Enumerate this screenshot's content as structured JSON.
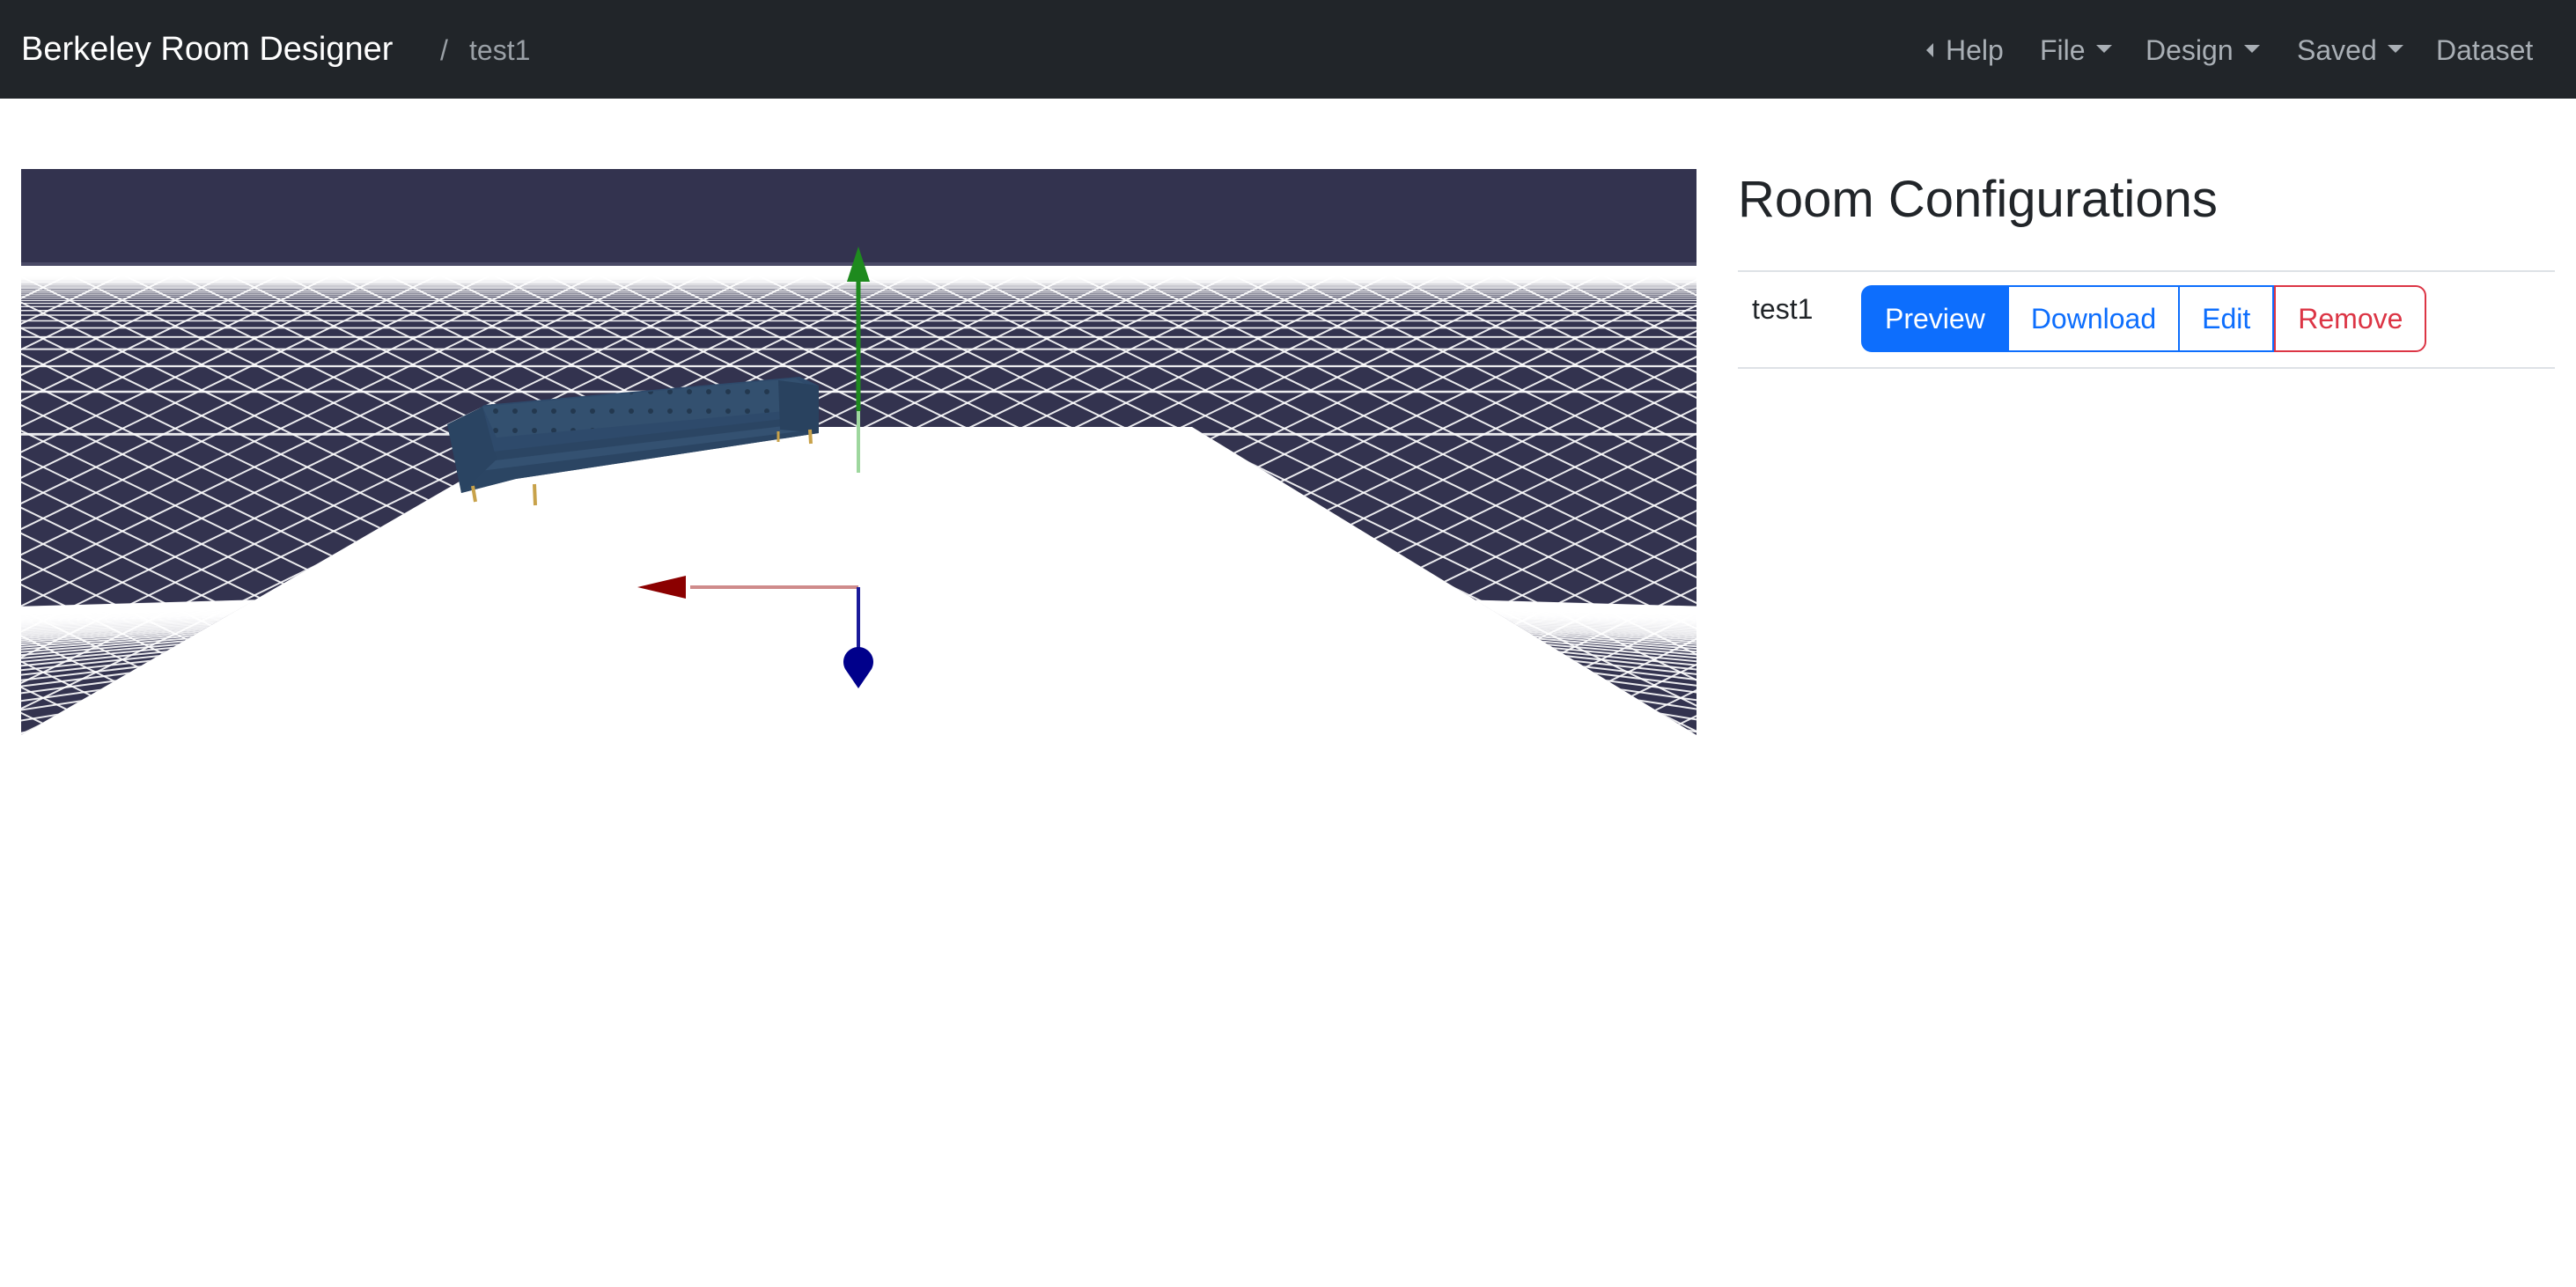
{
  "navbar": {
    "brand": "Berkeley Room Designer",
    "breadcrumb_separator": "/",
    "breadcrumb_current": "test1",
    "items": [
      {
        "label": "Help",
        "icon": "caret-left-icon"
      },
      {
        "label": "File",
        "icon": "caret-down-icon"
      },
      {
        "label": "Design",
        "icon": "caret-down-icon"
      },
      {
        "label": "Saved",
        "icon": "caret-down-icon"
      },
      {
        "label": "Dataset"
      }
    ]
  },
  "viewport": {
    "scene": "3d-room-preview",
    "object": "sofa",
    "gizmo_axes": {
      "x": "#8b0000",
      "y": "#1e8a1e",
      "z": "#00008b"
    },
    "colors": {
      "sky": "#33334f",
      "floor": "#33334f",
      "grid": "#ffffff",
      "sofa": "#2e4a6b"
    }
  },
  "panel": {
    "title": "Room Configurations",
    "configs": [
      {
        "name": "test1",
        "actions": {
          "preview": "Preview",
          "download": "Download",
          "edit": "Edit",
          "remove": "Remove"
        }
      }
    ]
  },
  "colors": {
    "navbar_bg": "#212529",
    "primary": "#0d6efd",
    "danger": "#dc3545"
  }
}
